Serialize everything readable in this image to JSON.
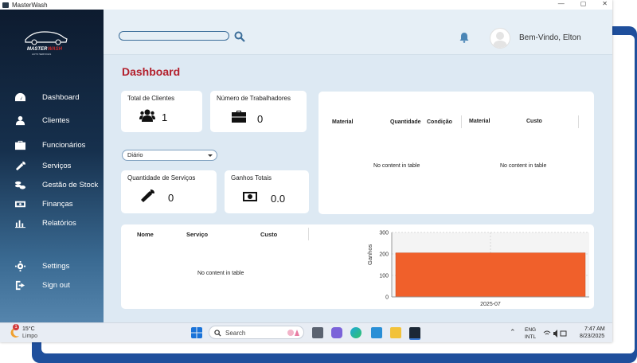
{
  "window": {
    "title": "MasterWash",
    "controls": [
      "—",
      "▢",
      "✕"
    ]
  },
  "logo": {
    "brand_master": "MASTER",
    "brand_wash": "WASH",
    "tagline": "AUTO SERVICES"
  },
  "sidebar": {
    "items": [
      {
        "label": "Dashboard",
        "icon": "dashboard-gauge-icon"
      },
      {
        "label": "Clientes",
        "icon": "users-icon"
      },
      {
        "label": "Funcionários",
        "icon": "briefcase-icon"
      },
      {
        "label": "Serviços",
        "icon": "wrench-icon"
      },
      {
        "label": "Gestão de Stock",
        "icon": "coins-icon"
      },
      {
        "label": "Finanças",
        "icon": "money-icon"
      },
      {
        "label": "Relatórios",
        "icon": "bar-chart-icon"
      }
    ],
    "bottom_items": [
      {
        "label": "Settings",
        "icon": "gear-icon"
      },
      {
        "label": "Sign out",
        "icon": "sign-out-icon"
      }
    ]
  },
  "topbar": {
    "search_value": "",
    "welcome": "Bem-Vindo, Elton"
  },
  "page": {
    "title": "Dashboard"
  },
  "stats": {
    "total_clientes": {
      "title": "Total de Clientes",
      "value": "1"
    },
    "num_trabalhadores": {
      "title": "Número de Trabalhadores",
      "value": "0"
    },
    "period_select": "Diário",
    "qtd_servicos": {
      "title": "Quantidade de Serviços",
      "value": "0"
    },
    "ganhos_totais": {
      "title": "Ganhos Totais",
      "value": "0.0"
    }
  },
  "stock_table": {
    "columns": [
      "Material",
      "Quantidade",
      "Condição"
    ],
    "empty": "No content in table"
  },
  "cost_table": {
    "columns": [
      "Material",
      "Custo"
    ],
    "empty": "No content in table"
  },
  "services_table": {
    "columns": [
      "Nome",
      "Serviço",
      "Custo"
    ],
    "empty": "No content in table"
  },
  "chart_data": {
    "type": "bar",
    "categories": [
      "2025-07"
    ],
    "values": [
      205
    ],
    "ylabel": "Ganhos",
    "xlabel": "",
    "ylim": [
      0,
      300
    ],
    "yticks": [
      "0",
      "100",
      "200",
      "300"
    ],
    "bar_color": "#f0602b",
    "grid": true
  },
  "taskbar": {
    "weather_temp": "15°C",
    "weather_desc": "Limpo",
    "weather_badge": "1",
    "search_placeholder": "Search",
    "lang_1": "ENG",
    "lang_2": "INTL",
    "time": "7:47 AM",
    "date": "8/23/2025"
  },
  "colors": {
    "accent": "#b3202d",
    "sidebar_top": "#0d1b2f",
    "sidebar_bottom": "#5585ad",
    "background": "#dde9f3"
  }
}
